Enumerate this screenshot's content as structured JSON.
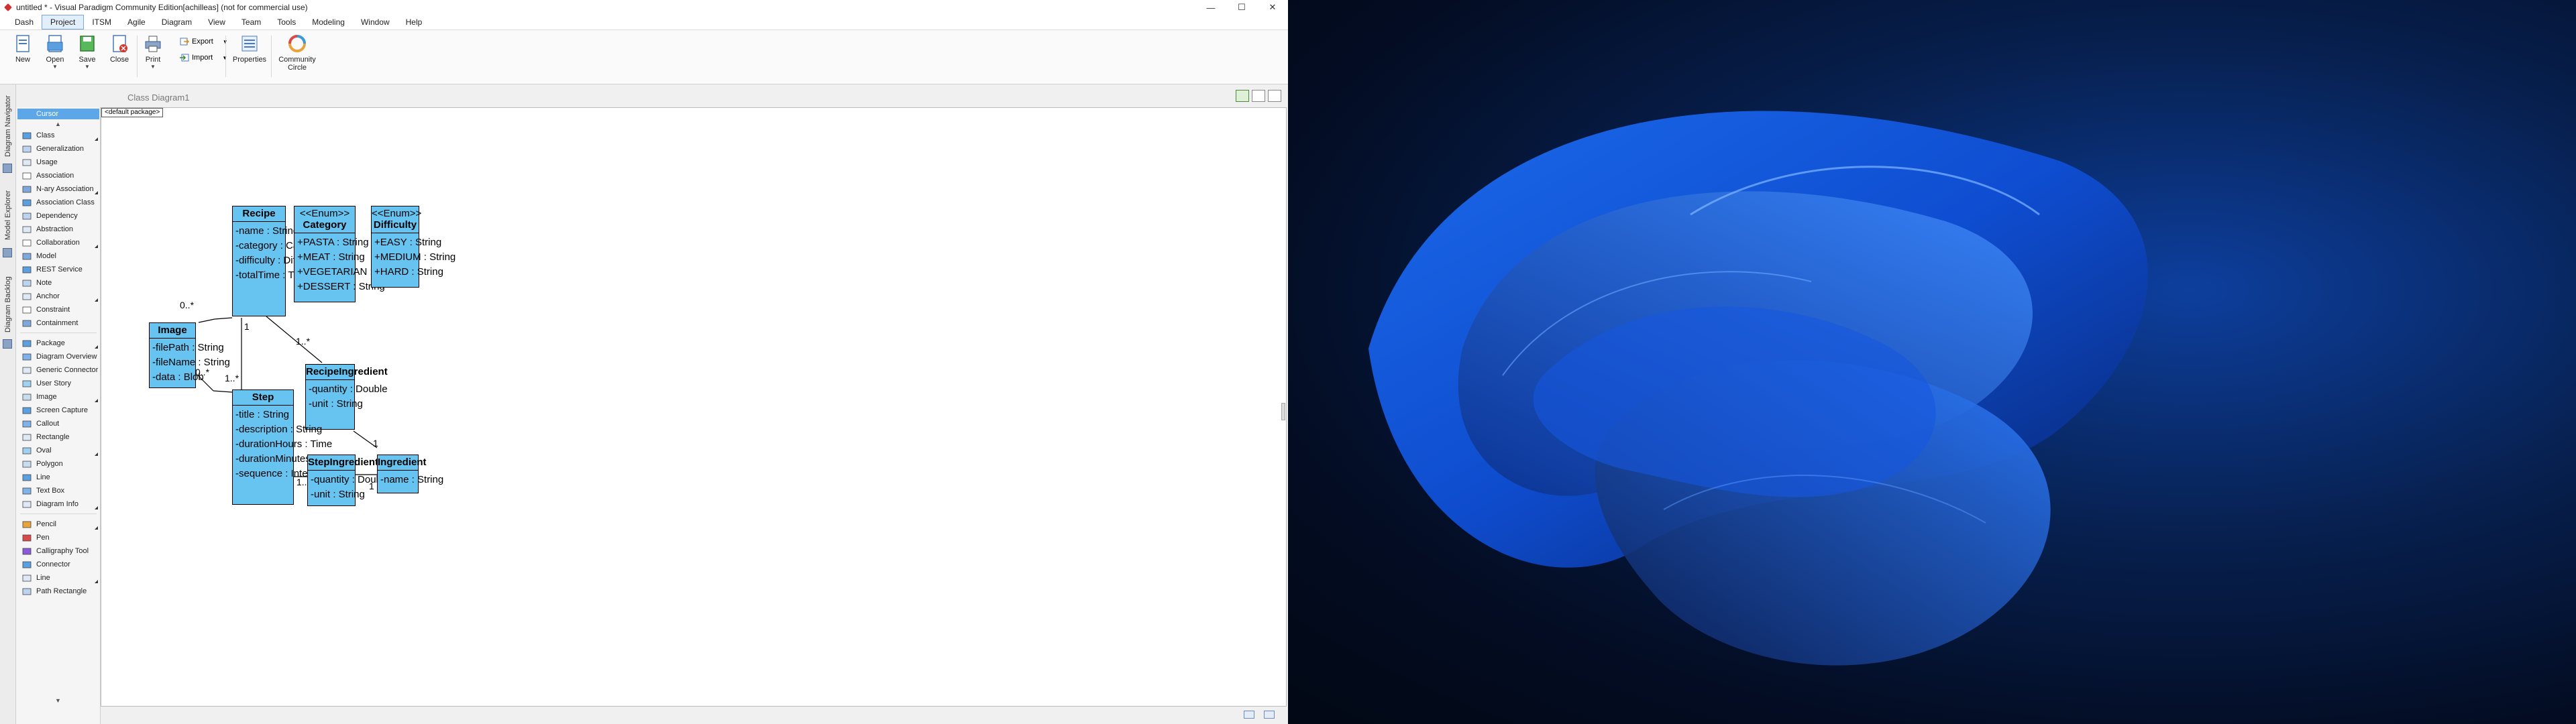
{
  "window": {
    "title": "untitled * - Visual Paradigm Community Edition[achilleas] (not for commercial use)",
    "controls": [
      "—",
      "☐",
      "✕"
    ]
  },
  "menu": [
    "Dash",
    "Project",
    "ITSM",
    "Agile",
    "Diagram",
    "View",
    "Team",
    "Tools",
    "Modeling",
    "Window",
    "Help"
  ],
  "menu_active": "Project",
  "ribbon": {
    "new": "New",
    "open": "Open",
    "save": "Save",
    "close": "Close",
    "print": "Print",
    "export": "Export",
    "import": "Import",
    "properties": "Properties",
    "community_circle": "Community\nCircle"
  },
  "vertical_tabs": [
    "Diagram Navigator",
    "Model Explorer",
    "Diagram Backlog"
  ],
  "palette": {
    "cursor": "Cursor",
    "items": [
      "Class",
      "Generalization",
      "Usage",
      "Association",
      "N-ary Association",
      "Association Class",
      "Dependency",
      "Abstraction",
      "Collaboration",
      "Model",
      "REST Service",
      "Note",
      "Anchor",
      "Constraint",
      "Containment"
    ],
    "items2": [
      "Package",
      "Diagram Overview",
      "Generic Connector",
      "User Story",
      "Image",
      "Screen Capture",
      "Callout",
      "Rectangle",
      "Oval",
      "Polygon",
      "Line",
      "Text Box",
      "Diagram Info"
    ],
    "items3": [
      "Pencil",
      "Pen",
      "Calligraphy Tool",
      "Connector",
      "Line",
      "Path Rectangle"
    ]
  },
  "diagram": {
    "title": "Class Diagram1",
    "package_tab": "<default package>",
    "classes": {
      "recipe": {
        "name": "Recipe",
        "attrs": [
          "-name : String",
          "-category : Category",
          "-difficulty : Difficulty",
          "-totalTime : Time"
        ]
      },
      "category": {
        "stereotype": "<<Enum>>",
        "name": "Category",
        "attrs": [
          "+PASTA : String",
          "+MEAT : String",
          "+VEGETARIAN : String",
          "+DESSERT : String"
        ]
      },
      "difficulty": {
        "stereotype": "<<Enum>>",
        "name": "Difficulty",
        "attrs": [
          "+EASY : String",
          "+MEDIUM : String",
          "+HARD : String"
        ]
      },
      "image": {
        "name": "Image",
        "attrs": [
          "-filePath : String",
          "-fileName : String",
          "-data : Blob"
        ]
      },
      "recipe_ingredient": {
        "name": "RecipeIngredient",
        "attrs": [
          "-quantity : Double",
          "-unit : String"
        ]
      },
      "step": {
        "name": "Step",
        "attrs": [
          "-title : String",
          "-description : String",
          "-durationHours : Time",
          "-durationMinutes : Time",
          "-sequence : Integer"
        ]
      },
      "step_ingredient": {
        "name": "StepIngredient",
        "attrs": [
          "-quantity : Double",
          "-unit : String"
        ]
      },
      "ingredient": {
        "name": "Ingredient",
        "attrs": [
          "-name : String"
        ]
      }
    },
    "multiplicities": {
      "image_recipe": "0..*",
      "recipe_step_top": "1",
      "recipe_ri_one": "1",
      "recipe_ri_many": "1..*",
      "image_step": "0..*",
      "step_many": "1..*",
      "ri_ingredient": "1",
      "step_si_one": "1",
      "si_many": "1..*",
      "ingredient_one": "1"
    }
  },
  "colors": {
    "class_fill": "#67c3f0",
    "palette_selected": "#5da6e8"
  }
}
